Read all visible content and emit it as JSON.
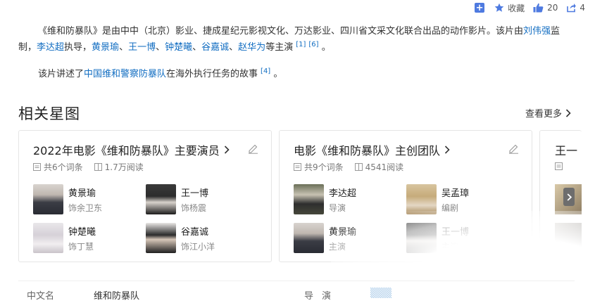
{
  "toolbar": {
    "favorite_label": "收藏",
    "like_count": "20",
    "share_count": "4"
  },
  "summary": {
    "p1_prefix": "《维和防暴队》是由中中（北京）影业、捷成星纪元影视文化、万达影业、四川省文采文化联合出品的动作影片。该片由",
    "director_link": "刘伟强",
    "p1_supervise": "监制，",
    "writer_link": "李达超",
    "p1_direct": "执导，",
    "cast_links": [
      "黄景瑜",
      "王一博",
      "钟楚曦",
      "谷嘉诚",
      "赵华为"
    ],
    "sep": "、",
    "p1_starring": "等主演",
    "refs1": [
      "[1]",
      "[6]"
    ],
    "p1_end": "。",
    "p2_prefix": "该片讲述了",
    "p2_link": "中国维和警察防暴队",
    "p2_suffix": "在海外执行任务的故事",
    "ref2": "[4]",
    "p2_end": "。"
  },
  "section": {
    "title": "相关星图",
    "see_more": "查看更多"
  },
  "cards": [
    {
      "title": "2022年电影《维和防暴队》主要演员",
      "entries": "共6个词条",
      "views": "1.7万阅读",
      "people": [
        {
          "name": "黄景瑜",
          "role": "饰余卫东"
        },
        {
          "name": "王一博",
          "role": "饰杨震"
        },
        {
          "name": "钟楚曦",
          "role": "饰丁慧"
        },
        {
          "name": "谷嘉诚",
          "role": "饰江小洋"
        }
      ]
    },
    {
      "title": "电影《维和防暴队》主创团队",
      "entries": "共9个词条",
      "views": "4541阅读",
      "people": [
        {
          "name": "李达超",
          "role": "导演"
        },
        {
          "name": "吴孟璋",
          "role": "编剧"
        },
        {
          "name": "黄景瑜",
          "role": "主演"
        },
        {
          "name": "王一博",
          "role": "主演"
        }
      ]
    },
    {
      "title": "王一"
    }
  ],
  "info": {
    "label1": "中文名",
    "value1": "维和防暴队",
    "label2": "导演"
  },
  "colors": {
    "link": "#136ec2",
    "accent": "#4e7ae0",
    "border": "#e5e5e5"
  }
}
